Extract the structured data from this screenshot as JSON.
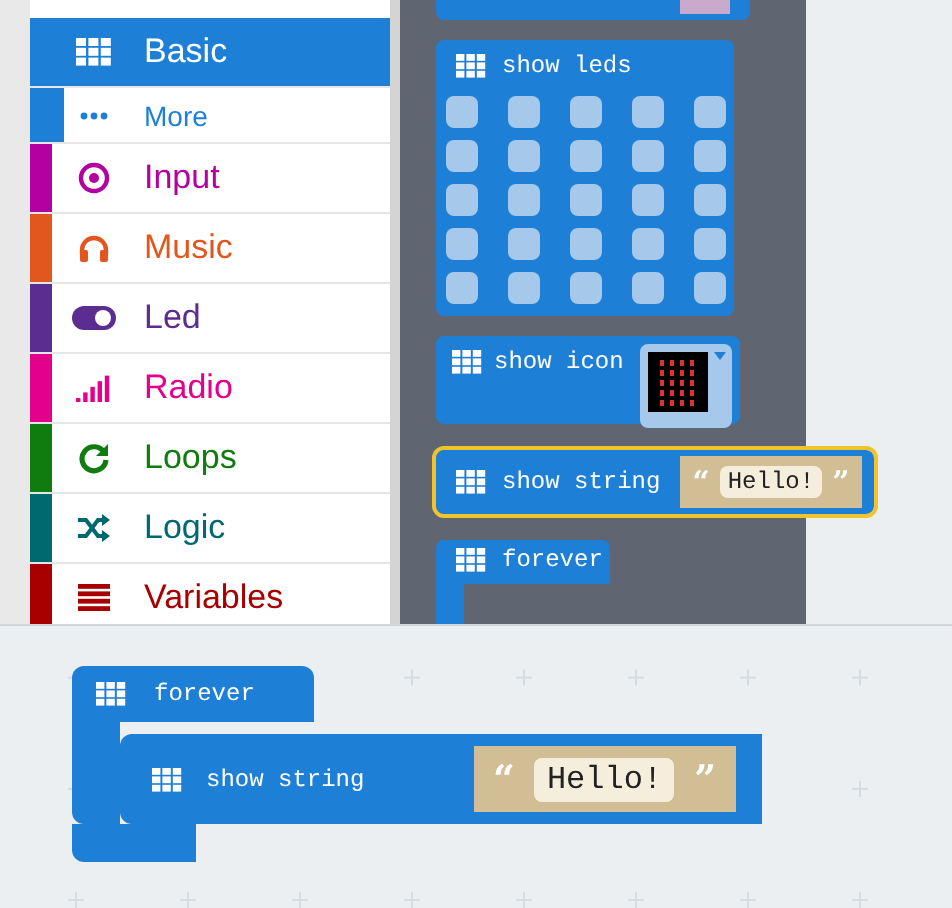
{
  "toolbox": {
    "categories": [
      {
        "label": "Basic",
        "kind": "category",
        "color": "#1e7fd6",
        "selected": true
      },
      {
        "label": "More",
        "kind": "subcategory",
        "color": "#1e7fd6",
        "selected": false
      },
      {
        "label": "Input",
        "kind": "category",
        "color": "#b4009e",
        "selected": false
      },
      {
        "label": "Music",
        "kind": "category",
        "color": "#e2571e",
        "selected": false
      },
      {
        "label": "Led",
        "kind": "category",
        "color": "#5c2d91",
        "selected": false
      },
      {
        "label": "Radio",
        "kind": "category",
        "color": "#e3008c",
        "selected": false
      },
      {
        "label": "Loops",
        "kind": "category",
        "color": "#107c10",
        "selected": false
      },
      {
        "label": "Logic",
        "kind": "category",
        "color": "#006970",
        "selected": false
      },
      {
        "label": "Variables",
        "kind": "category",
        "color": "#a80000",
        "selected": false
      }
    ]
  },
  "flyout": {
    "blocks": [
      {
        "kind": "partial",
        "selected": false
      },
      {
        "kind": "leds",
        "label": "show leds",
        "selected": false
      },
      {
        "kind": "icon",
        "label": "show icon",
        "selected": false
      },
      {
        "kind": "string",
        "label": "show string",
        "open_quote": "“",
        "value": "Hello!",
        "close_quote": "”",
        "selected": true
      },
      {
        "kind": "hat",
        "label": "forever",
        "selected": false
      }
    ]
  },
  "workspace": {
    "forever": {
      "label": "forever",
      "body": {
        "label": "show string",
        "open_quote": "“",
        "value": "Hello!",
        "close_quote": "”"
      }
    }
  }
}
